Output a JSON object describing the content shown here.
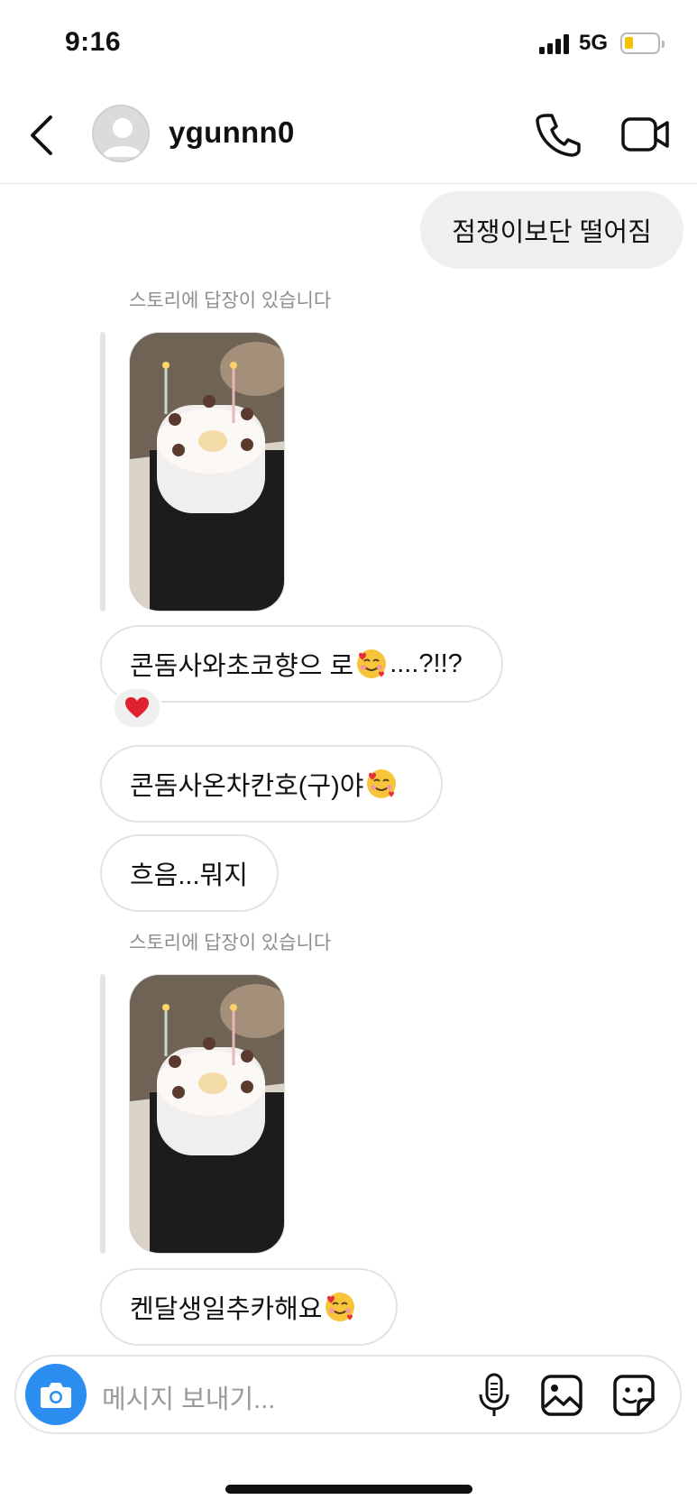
{
  "status_bar": {
    "time": "9:16",
    "network": "5G",
    "battery_color": "#f5c400"
  },
  "header": {
    "username": "ygunnn0",
    "icons": [
      "chevron-left-icon",
      "avatar-placeholder",
      "phone-icon",
      "video-camera-icon"
    ]
  },
  "messages": [
    {
      "type": "outgoing",
      "text": "점쟁이보단 떨어짐"
    },
    {
      "type": "story_reply_label",
      "text": "스토리에 답장이 있습니다"
    },
    {
      "type": "story_thumbnail",
      "image": "birthday cake with bear decorations and candles"
    },
    {
      "type": "incoming",
      "before": "콘돔사와초코향으 로",
      "emoji": "smiling-face-with-hearts",
      "after": "....?!!?",
      "reaction": "❤️"
    },
    {
      "type": "incoming",
      "before": "콘돔사온차칸호(구)야",
      "emoji": "smiling-face-with-hearts",
      "after": ""
    },
    {
      "type": "incoming",
      "before": "흐음...뭐지",
      "emoji": "",
      "after": ""
    },
    {
      "type": "story_reply_label",
      "text": "스토리에 답장이 있습니다"
    },
    {
      "type": "story_thumbnail",
      "image": "birthday cake with bear decorations and candles"
    },
    {
      "type": "incoming",
      "before": "켄달생일추카해요",
      "emoji": "smiling-face-with-hearts",
      "after": ""
    }
  ],
  "composer": {
    "placeholder": "메시지 보내기...",
    "icons": [
      "camera-icon",
      "microphone-icon",
      "gallery-icon",
      "sticker-icon"
    ],
    "camera_color": "#2b8ef0"
  }
}
